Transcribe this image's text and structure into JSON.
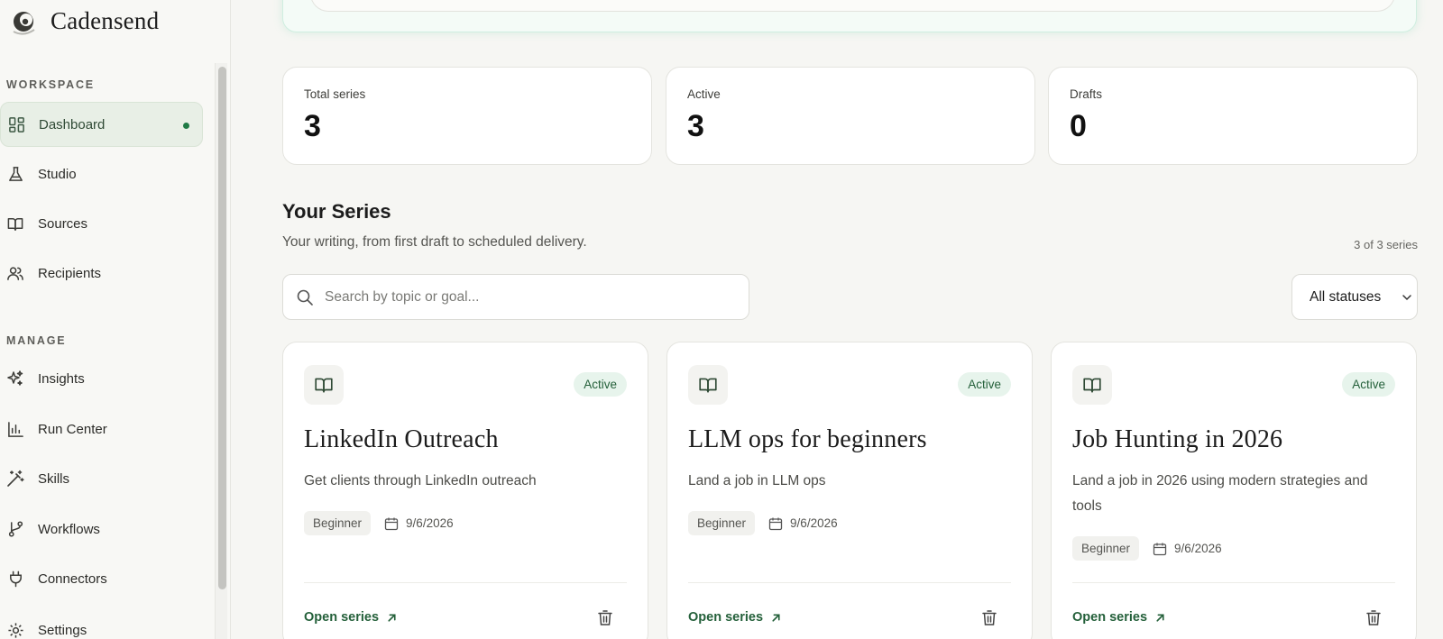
{
  "brand": {
    "name": "Cadensend"
  },
  "sidebar": {
    "sections": [
      {
        "label": "WORKSPACE",
        "items": [
          {
            "label": "Dashboard",
            "icon": "dashboard-icon",
            "active": true
          },
          {
            "label": "Studio",
            "icon": "flask-icon"
          },
          {
            "label": "Sources",
            "icon": "book-icon"
          },
          {
            "label": "Recipients",
            "icon": "users-icon"
          }
        ]
      },
      {
        "label": "MANAGE",
        "items": [
          {
            "label": "Insights",
            "icon": "sparkles-icon"
          },
          {
            "label": "Run Center",
            "icon": "bar-chart-icon"
          },
          {
            "label": "Skills",
            "icon": "magic-wand-icon"
          },
          {
            "label": "Workflows",
            "icon": "git-branch-icon"
          },
          {
            "label": "Connectors",
            "icon": "plug-icon"
          },
          {
            "label": "Settings",
            "icon": "gear-icon"
          }
        ]
      }
    ]
  },
  "stats": [
    {
      "label": "Total series",
      "value": "3"
    },
    {
      "label": "Active",
      "value": "3"
    },
    {
      "label": "Drafts",
      "value": "0"
    }
  ],
  "series_section": {
    "title": "Your Series",
    "subtitle": "Your writing, from first draft to scheduled delivery.",
    "count": "3 of 3 series",
    "search_placeholder": "Search by topic or goal...",
    "status_filter": "All statuses"
  },
  "series": [
    {
      "title": "LinkedIn Outreach",
      "description": "Get clients through LinkedIn outreach",
      "status": "Active",
      "level": "Beginner",
      "date": "9/6/2026",
      "open_label": "Open series"
    },
    {
      "title": "LLM ops for beginners",
      "description": "Land a job in LLM ops",
      "status": "Active",
      "level": "Beginner",
      "date": "9/6/2026",
      "open_label": "Open series"
    },
    {
      "title": "Job Hunting in 2026",
      "description": "Land a job in 2026 using modern strategies and tools",
      "status": "Active",
      "level": "Beginner",
      "date": "9/6/2026",
      "open_label": "Open series"
    }
  ],
  "colors": {
    "accent": "#24603a",
    "active_badge_bg": "#e7f4ec",
    "active_nav_bg": "#e8efe6",
    "page_bg": "#f6f6f3"
  }
}
